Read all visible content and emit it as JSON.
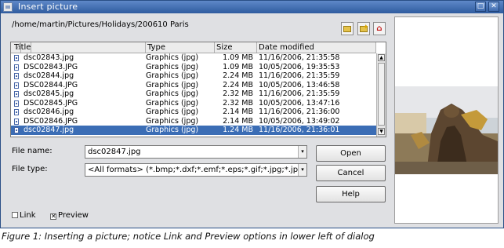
{
  "window": {
    "title": "Insert picture",
    "controls": [
      "restore",
      "close"
    ]
  },
  "path": "/home/martin/Pictures/Holidays/200610 Paris",
  "toolbar": {
    "buttons": [
      "new-folder-icon",
      "create-folder-icon",
      "up-one-level-icon"
    ]
  },
  "file_list": {
    "columns": [
      "Title",
      "Type",
      "Size",
      "Date modified"
    ],
    "rows": [
      {
        "name": "dsc02843.jpg",
        "type": "Graphics (jpg)",
        "size": "1.09 MB",
        "date": "11/16/2006, 21:35:58",
        "selected": false
      },
      {
        "name": "DSC02843.JPG",
        "type": "Graphics (jpg)",
        "size": "1.09 MB",
        "date": "10/05/2006, 19:35:53",
        "selected": false
      },
      {
        "name": "dsc02844.jpg",
        "type": "Graphics (jpg)",
        "size": "2.24 MB",
        "date": "11/16/2006, 21:35:59",
        "selected": false
      },
      {
        "name": "DSC02844.JPG",
        "type": "Graphics (jpg)",
        "size": "2.24 MB",
        "date": "10/05/2006, 13:46:58",
        "selected": false
      },
      {
        "name": "dsc02845.jpg",
        "type": "Graphics (jpg)",
        "size": "2.32 MB",
        "date": "11/16/2006, 21:35:59",
        "selected": false
      },
      {
        "name": "DSC02845.JPG",
        "type": "Graphics (jpg)",
        "size": "2.32 MB",
        "date": "10/05/2006, 13:47:16",
        "selected": false
      },
      {
        "name": "dsc02846.jpg",
        "type": "Graphics (jpg)",
        "size": "2.14 MB",
        "date": "11/16/2006, 21:36:00",
        "selected": false
      },
      {
        "name": "DSC02846.JPG",
        "type": "Graphics (jpg)",
        "size": "2.14 MB",
        "date": "10/05/2006, 13:49:02",
        "selected": false
      },
      {
        "name": "dsc02847.jpg",
        "type": "Graphics (jpg)",
        "size": "1.24 MB",
        "date": "11/16/2006, 21:36:01",
        "selected": true
      }
    ]
  },
  "form": {
    "file_name_label": "File name:",
    "file_name_value": "dsc02847.jpg",
    "file_type_label": "File type:",
    "file_type_value": "<All formats> (*.bmp;*.dxf;*.emf;*.eps;*.gif;*.jpg;*.jpeg;*"
  },
  "buttons": {
    "open": "Open",
    "cancel": "Cancel",
    "help": "Help"
  },
  "options": {
    "link_label": "Link",
    "link_checked": false,
    "preview_label": "Preview",
    "preview_checked": true
  },
  "caption": "Figure 1: Inserting a picture; notice Link and Preview options in lower left of dialog",
  "colors": {
    "titlebar": "#3b6db5",
    "selection": "#3b6db5",
    "dialog_bg": "#dfe0e3"
  }
}
